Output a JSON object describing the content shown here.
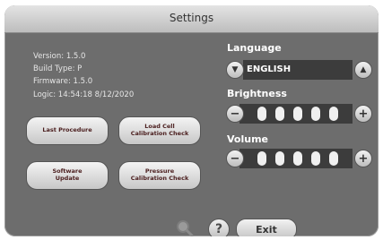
{
  "title": "Settings",
  "info": {
    "version": "Version:  1.5.0",
    "build_type": "Build Type:  P",
    "firmware": "Firmware:  1.5.0",
    "logic": "Logic:  14:54:18  8/12/2020"
  },
  "buttons": {
    "last_procedure": "Last Procedure",
    "load_cell": "Load Cell\nCalibration Check",
    "software_update": "Software\nUpdate",
    "pressure_calibration": "Pressure\nCalibration Check"
  },
  "language": {
    "label": "Language",
    "value": "ENGLISH",
    "down": "▼",
    "up": "▲"
  },
  "brightness": {
    "label": "Brightness",
    "level_filled": 5,
    "level_max": 5,
    "minus": "−",
    "plus": "+"
  },
  "volume": {
    "label": "Volume",
    "level_filled": 5,
    "level_max": 5,
    "minus": "−",
    "plus": "+"
  },
  "footer": {
    "help": "?",
    "exit": "Exit",
    "search_icon": "magnifier-icon"
  },
  "colors": {
    "panel": "#6d6d6d",
    "title_bar": "#cfcfcf",
    "field": "#3c3c3c"
  }
}
